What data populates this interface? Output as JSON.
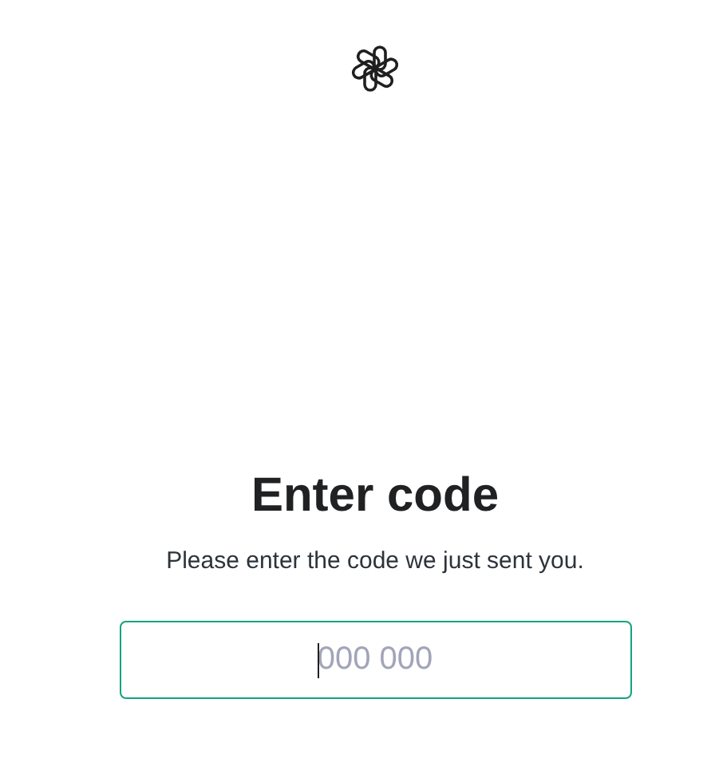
{
  "title": "Enter code",
  "subtitle": "Please enter the code we just sent you.",
  "code_field": {
    "placeholder": "000 000",
    "focused": true
  }
}
